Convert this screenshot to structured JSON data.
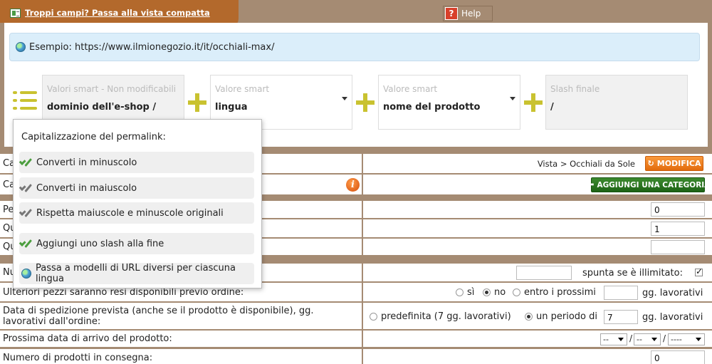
{
  "header": {
    "compact_link": "Troppi campi? Passa alla vista compatta",
    "help_label": "Help"
  },
  "example": {
    "label": "Esempio: https://www.ilmionegozio.it/it/occhiali-max/"
  },
  "segments": [
    {
      "placeholder": "Valori smart - Non modificabili",
      "value": "dominio dell'e-shop /"
    },
    {
      "placeholder": "Valore smart",
      "value": "lingua"
    },
    {
      "placeholder": "Valore smart",
      "value": "nome del prodotto"
    },
    {
      "placeholder": "Slash finale",
      "value": "/"
    }
  ],
  "popup": {
    "title": "Capitalizzazione del permalink:",
    "options": [
      "Converti in minuscolo",
      "Converti in maiuscolo",
      "Rispetta maiuscole e minuscole originali",
      "Aggiungi uno slash alla fine",
      "Passa a modelli di URL diversi per ciascuna lingua"
    ]
  },
  "rows": {
    "category": {
      "label": "Ca",
      "breadcrumb": "Vista > Occhiali da Sole",
      "button": "MODIFICA"
    },
    "add_category": {
      "label": "Ca",
      "button": "AGGIUNGI UNA CATEGORIA"
    },
    "pe": {
      "label": "Pe",
      "value": "0"
    },
    "qu1": {
      "label": "Qu",
      "value": "1"
    },
    "qu2": {
      "label": "Qu",
      "value": ""
    },
    "nu": {
      "label": "Nu",
      "value": "",
      "check_label": "spunta se è illimitato:"
    },
    "pezzi": {
      "label": "Ulteriori pezzi saranno resi disponibili previo ordine:",
      "opt_si": "sì",
      "opt_no": "no",
      "opt_entro": "entro i prossimi",
      "days_value": "",
      "unit": "gg. lavorativi"
    },
    "spedizione": {
      "label": "Data di spedizione prevista (anche se il prodotto è disponibile), gg. lavorativi dall'ordine:",
      "opt_default": "predefinita (7 gg. lavorativi)",
      "opt_period": "un periodo di",
      "period_value": "7",
      "unit": "gg. lavorativi"
    },
    "arrivo": {
      "label": "Prossima data di arrivo del prodotto:",
      "sel1": "--",
      "sel2": "--",
      "sel3": "----",
      "sep": "/"
    },
    "consegna": {
      "label": "Numero di prodotti in consegna:",
      "value": "0"
    }
  }
}
